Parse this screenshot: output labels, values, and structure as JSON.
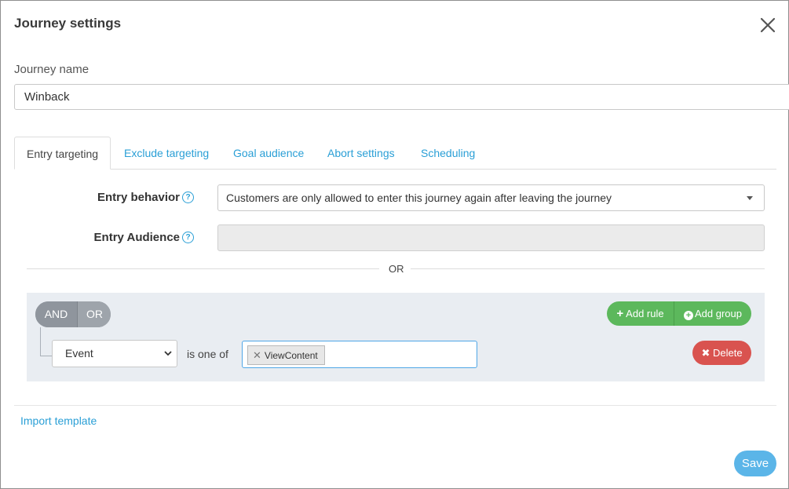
{
  "dialog": {
    "title": "Journey settings"
  },
  "journey_name": {
    "label": "Journey name",
    "value": "Winback"
  },
  "tabs": [
    {
      "label": "Entry targeting",
      "active": true
    },
    {
      "label": "Exclude targeting",
      "active": false
    },
    {
      "label": "Goal audience",
      "active": false
    },
    {
      "label": "Abort settings",
      "active": false
    },
    {
      "label": "Scheduling",
      "active": false
    }
  ],
  "entry_behavior": {
    "label": "Entry behavior",
    "value": "Customers are only allowed to enter this journey again after leaving the journey",
    "help_icon": "?"
  },
  "entry_audience": {
    "label": "Entry Audience",
    "value": "",
    "help_icon": "?"
  },
  "separator": {
    "text": "OR"
  },
  "rule_builder": {
    "condition_and": "AND",
    "condition_or": "OR",
    "add_rule": "Add rule",
    "add_group": "Add group",
    "rule": {
      "field": "Event",
      "operator": "is one of",
      "tags": [
        "ViewContent"
      ],
      "delete": "Delete"
    }
  },
  "footer": {
    "import_template": "Import template",
    "save": "Save"
  },
  "colors": {
    "accent": "#2a9fd6",
    "success": "#5cb85c",
    "danger": "#d9534f",
    "save": "#5bb5e8"
  }
}
